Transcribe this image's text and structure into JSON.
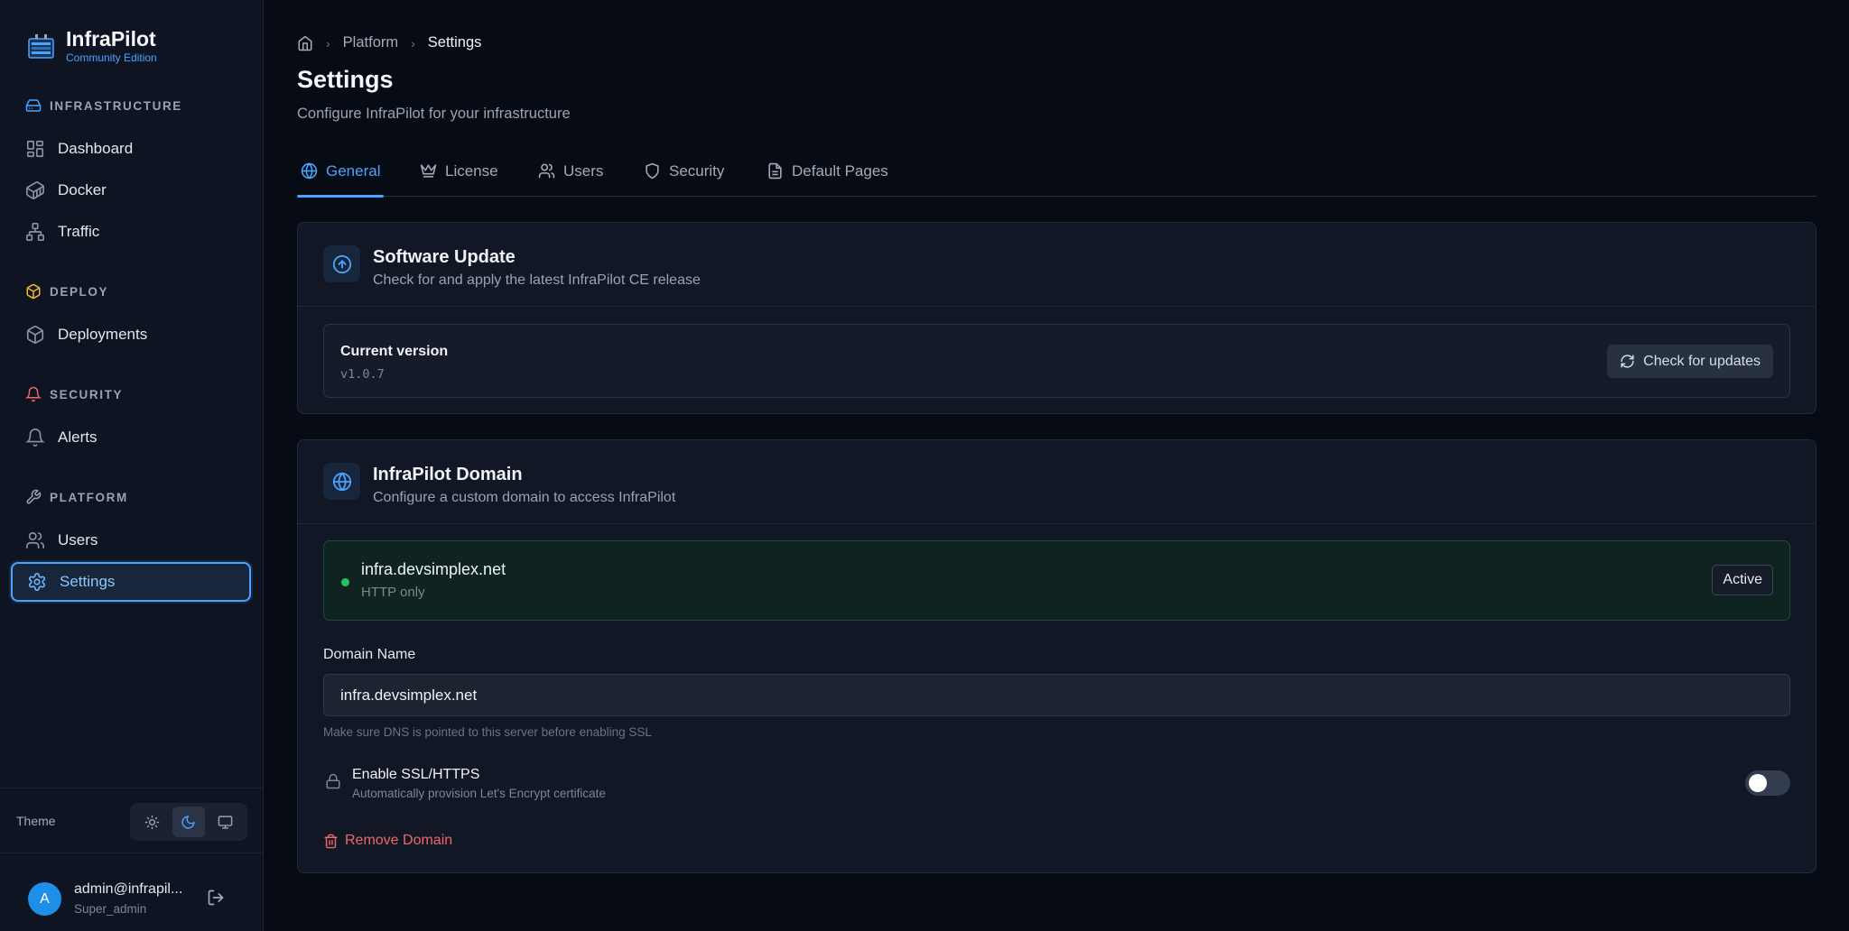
{
  "app": {
    "name": "InfraPilot",
    "edition": "Community Edition"
  },
  "sidebar": {
    "sections": [
      {
        "label": "INFRASTRUCTURE",
        "icon": "server-icon",
        "color": "#4aa3ff",
        "items": [
          {
            "label": "Dashboard",
            "icon": "dashboard-icon"
          },
          {
            "label": "Docker",
            "icon": "container-icon"
          },
          {
            "label": "Traffic",
            "icon": "network-icon"
          }
        ]
      },
      {
        "label": "DEPLOY",
        "icon": "package-icon",
        "color": "#f5b82e",
        "items": [
          {
            "label": "Deployments",
            "icon": "box-icon"
          }
        ]
      },
      {
        "label": "SECURITY",
        "icon": "bell-icon",
        "color": "#f0666b",
        "items": [
          {
            "label": "Alerts",
            "icon": "bell-icon"
          }
        ]
      },
      {
        "label": "PLATFORM",
        "icon": "wrench-icon",
        "color": "#9aa3b3",
        "items": [
          {
            "label": "Users",
            "icon": "users-icon"
          },
          {
            "label": "Settings",
            "icon": "gear-icon",
            "active": true
          }
        ]
      }
    ],
    "theme": {
      "label": "Theme",
      "options": [
        "light",
        "dark",
        "system"
      ],
      "selected": "dark"
    },
    "user": {
      "initial": "A",
      "name": "admin@infrapil...",
      "role": "Super_admin"
    }
  },
  "breadcrumb": {
    "home_icon": "home-icon",
    "items": [
      "Platform",
      "Settings"
    ]
  },
  "page": {
    "title": "Settings",
    "subtitle": "Configure InfraPilot for your infrastructure"
  },
  "tabs": [
    {
      "label": "General",
      "icon": "globe-icon",
      "active": true
    },
    {
      "label": "License",
      "icon": "crown-icon"
    },
    {
      "label": "Users",
      "icon": "users-icon"
    },
    {
      "label": "Security",
      "icon": "shield-icon"
    },
    {
      "label": "Default Pages",
      "icon": "file-icon"
    }
  ],
  "software_update": {
    "title": "Software Update",
    "description": "Check for and apply the latest InfraPilot CE release",
    "current_version_label": "Current version",
    "current_version": "v1.0.7",
    "check_button": "Check for updates"
  },
  "domain": {
    "title": "InfraPilot Domain",
    "description": "Configure a custom domain to access InfraPilot",
    "status": {
      "host": "infra.devsimplex.net",
      "protocol": "HTTP only",
      "badge": "Active",
      "color": "#22c55e"
    },
    "field_label": "Domain Name",
    "value": "infra.devsimplex.net",
    "hint": "Make sure DNS is pointed to this server before enabling SSL",
    "ssl": {
      "title": "Enable SSL/HTTPS",
      "description": "Automatically provision Let's Encrypt certificate",
      "enabled": false
    },
    "remove_button": "Remove Domain"
  },
  "colors": {
    "accent": "#4aa3ff",
    "danger": "#f0666b",
    "success": "#22c55e",
    "background": "#070b14"
  }
}
